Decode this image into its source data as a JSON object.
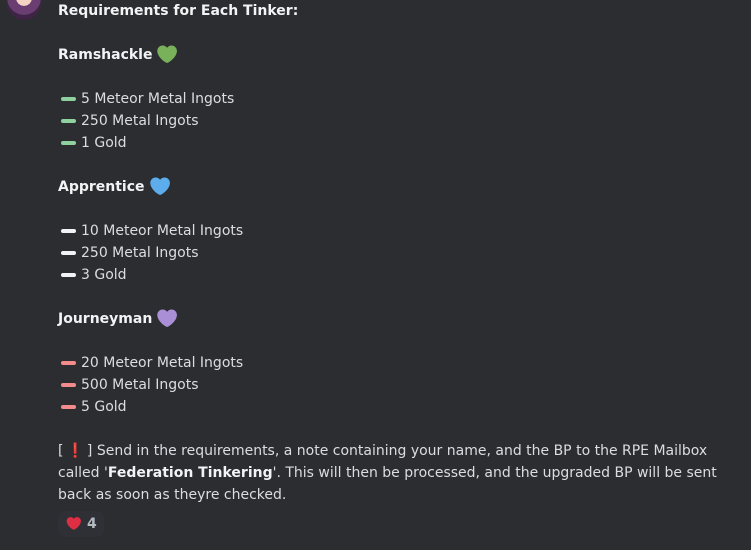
{
  "message": {
    "title": "Requirements for Each Tinker:",
    "tiers": [
      {
        "name": "Ramshackle",
        "heart_icon": "green-heart-icon",
        "color": "#78b159",
        "dash_color": "#8fd19e",
        "items": [
          "5 Meteor Metal Ingots",
          "250 Metal Ingots",
          "1 Gold"
        ]
      },
      {
        "name": "Apprentice",
        "heart_icon": "blue-heart-icon",
        "color": "#5dadec",
        "dash_color": "#f2f3f5",
        "items": [
          "10 Meteor Metal Ingots",
          "250 Metal Ingots",
          "3 Gold"
        ]
      },
      {
        "name": "Journeyman",
        "heart_icon": "purple-heart-icon",
        "color": "#aa8ed6",
        "dash_color": "#f38b8b",
        "items": [
          "20 Meteor Metal Ingots",
          "500 Metal Ingots",
          "5 Gold"
        ]
      }
    ],
    "note": {
      "prefix": "[",
      "exclamation": "❗",
      "suffix": "] Send in the requirements, a note containing your name, and the BP to the RPE Mailbox called '",
      "mailbox_name": "Federation Tinkering",
      "end": "'. This will then be processed, and the upgraded BP will be sent back as soon as theyre checked."
    }
  },
  "reaction": {
    "icon": "red-heart-icon",
    "count": "4",
    "color": "#dd2e44"
  }
}
